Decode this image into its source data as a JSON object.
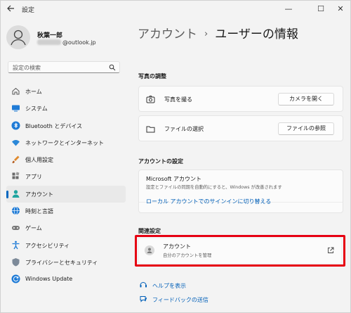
{
  "window": {
    "title": "設定",
    "controls": {
      "minimize": "—",
      "maximize": "☐",
      "close": "✕"
    }
  },
  "user": {
    "name": "秋葉一郎",
    "email_suffix": "@outlook.jp"
  },
  "search": {
    "placeholder": "設定の検索"
  },
  "sidebar": {
    "items": [
      {
        "label": "ホーム",
        "icon": "home-icon"
      },
      {
        "label": "システム",
        "icon": "system-icon"
      },
      {
        "label": "Bluetooth とデバイス",
        "icon": "bluetooth-icon"
      },
      {
        "label": "ネットワークとインターネット",
        "icon": "network-icon"
      },
      {
        "label": "個人用設定",
        "icon": "brush-icon"
      },
      {
        "label": "アプリ",
        "icon": "apps-icon"
      },
      {
        "label": "アカウント",
        "icon": "account-icon",
        "active": true
      },
      {
        "label": "時刻と言語",
        "icon": "globe-icon"
      },
      {
        "label": "ゲーム",
        "icon": "gamepad-icon"
      },
      {
        "label": "アクセシビリティ",
        "icon": "accessibility-icon"
      },
      {
        "label": "プライバシーとセキュリティ",
        "icon": "shield-icon"
      },
      {
        "label": "Windows Update",
        "icon": "update-icon"
      }
    ]
  },
  "header": {
    "crumb": "アカウント",
    "separator": "›",
    "title": "ユーザーの情報"
  },
  "photo": {
    "heading": "写真の調整",
    "take_photo": {
      "label": "写真を撮る",
      "button": "カメラを開く"
    },
    "choose_file": {
      "label": "ファイルの選択",
      "button": "ファイルの参照"
    }
  },
  "account_settings": {
    "heading": "アカウントの設定",
    "ms_title": "Microsoft アカウント",
    "ms_desc": "設定とファイルの同期を自動的にすると、Windows が改善されます",
    "switch_link": "ローカル アカウントでのサインインに切り替える"
  },
  "related": {
    "heading": "関連設定",
    "title": "アカウント",
    "subtitle": "自分のアカウントを管理",
    "highlight_color": "#e60012"
  },
  "help": {
    "get_help": "ヘルプを表示",
    "feedback": "フィードバックの送信"
  },
  "colors": {
    "accent": "#0067c0",
    "link": "#005fb8",
    "background": "#f3f3f3"
  }
}
